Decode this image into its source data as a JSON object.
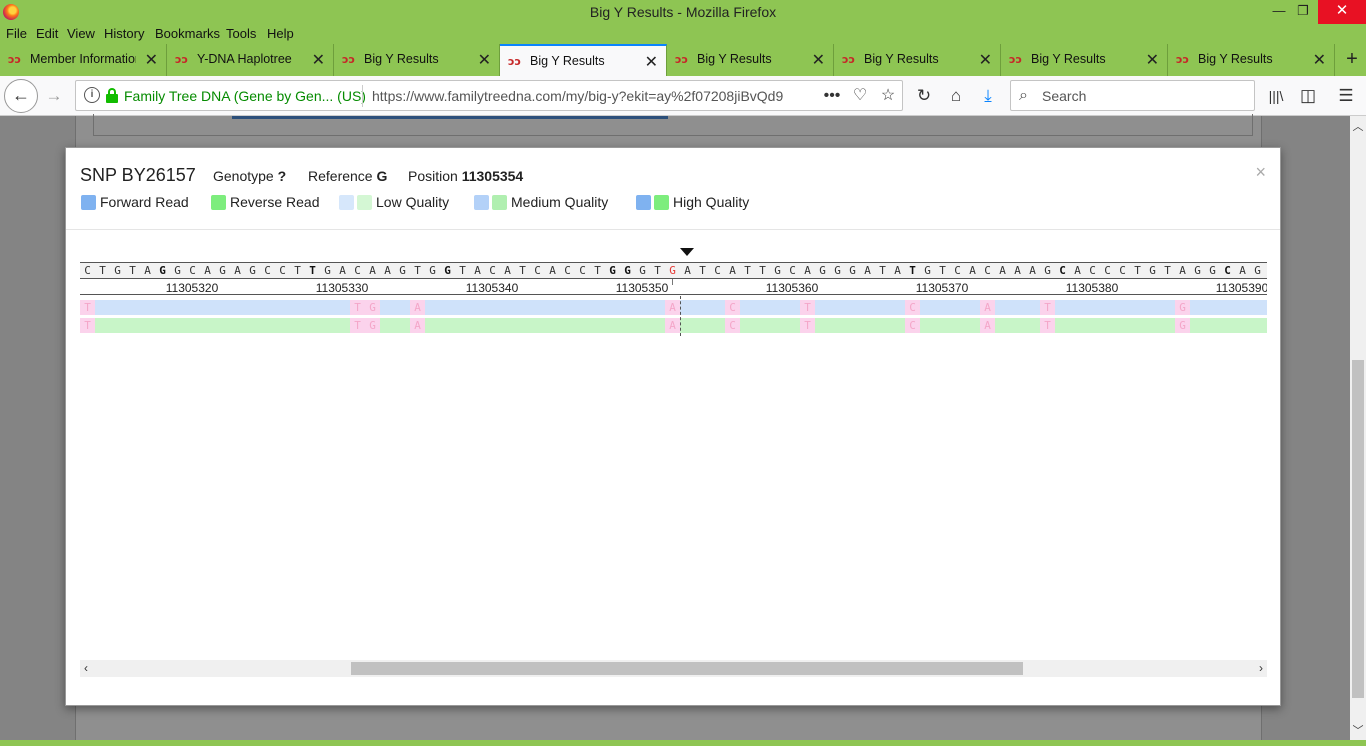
{
  "window": {
    "title": "Big Y Results - Mozilla Firefox",
    "minimize": "—",
    "maximize": "❐",
    "close": "✕"
  },
  "menu": [
    "File",
    "Edit",
    "View",
    "History",
    "Bookmarks",
    "Tools",
    "Help"
  ],
  "tabs": [
    {
      "label": "Member Information",
      "active": false
    },
    {
      "label": "Y-DNA Haplotree",
      "active": false
    },
    {
      "label": "Big Y Results",
      "active": false
    },
    {
      "label": "Big Y Results",
      "active": true
    },
    {
      "label": "Big Y Results",
      "active": false
    },
    {
      "label": "Big Y Results",
      "active": false
    },
    {
      "label": "Big Y Results",
      "active": false
    },
    {
      "label": "Big Y Results",
      "active": false
    }
  ],
  "tab_close": "✕",
  "tab_icon": "ↄↄ",
  "new_tab": "+",
  "navbar": {
    "site_identity": "Family Tree DNA (Gene by Gen...  (US)",
    "url": "https://www.familytreedna.com/my/big-y?ekit=ay%2f07208jiBvQd9",
    "search_placeholder": "Search"
  },
  "modal": {
    "title": "SNP BY26157",
    "genotype_label": "Genotype",
    "genotype_value": "?",
    "reference_label": "Reference",
    "reference_value": "G",
    "position_label": "Position",
    "position_value": "11305354",
    "close": "×",
    "legend": [
      {
        "label": "Forward Read",
        "colors": [
          "#7fb2f0"
        ]
      },
      {
        "label": "Reverse Read",
        "colors": [
          "#7ded7d"
        ]
      },
      {
        "label": "Low Quality",
        "colors": [
          "#d6e7fb",
          "#d4f7d4"
        ]
      },
      {
        "label": "Medium Quality",
        "colors": [
          "#b3d1f8",
          "#b0efb0"
        ]
      },
      {
        "label": "High Quality",
        "colors": [
          "#7fb2f0",
          "#7ded7d"
        ]
      }
    ]
  },
  "reference_sequence": "CTGTAGGCAGAGCCTTGACAAGTGGTACATCACCTGGGTGATCATTGCAGGGATATGTCACAAAGCACCCTGTAGGCAG",
  "bold_indices": [
    5,
    15,
    24,
    35,
    36,
    55,
    65,
    76
  ],
  "highlight_index": 39,
  "position_labels": [
    "11305320",
    "11305330",
    "11305340",
    "11305350",
    "11305360",
    "11305370",
    "11305380",
    "11305390"
  ],
  "forward_reads": [
    {
      "i": 0,
      "b": "T"
    },
    {
      "i": 18,
      "b": "T"
    },
    {
      "i": 19,
      "b": "G"
    },
    {
      "i": 22,
      "b": "A"
    },
    {
      "i": 39,
      "b": "A"
    },
    {
      "i": 43,
      "b": "C"
    },
    {
      "i": 48,
      "b": "T"
    },
    {
      "i": 55,
      "b": "C"
    },
    {
      "i": 60,
      "b": "A"
    },
    {
      "i": 64,
      "b": "T"
    },
    {
      "i": 73,
      "b": "G"
    }
  ],
  "reverse_reads": [
    {
      "i": 0,
      "b": "T"
    },
    {
      "i": 18,
      "b": "T"
    },
    {
      "i": 19,
      "b": "G"
    },
    {
      "i": 22,
      "b": "A"
    },
    {
      "i": 39,
      "b": "A"
    },
    {
      "i": 43,
      "b": "C"
    },
    {
      "i": 48,
      "b": "T"
    },
    {
      "i": 55,
      "b": "C"
    },
    {
      "i": 60,
      "b": "A"
    },
    {
      "i": 64,
      "b": "T"
    },
    {
      "i": 73,
      "b": "G"
    }
  ],
  "colors": {
    "chrome": "#8ec553",
    "accent": "#0a84ff",
    "secure_green": "#12bc00",
    "highlight_base": "#e53935"
  }
}
